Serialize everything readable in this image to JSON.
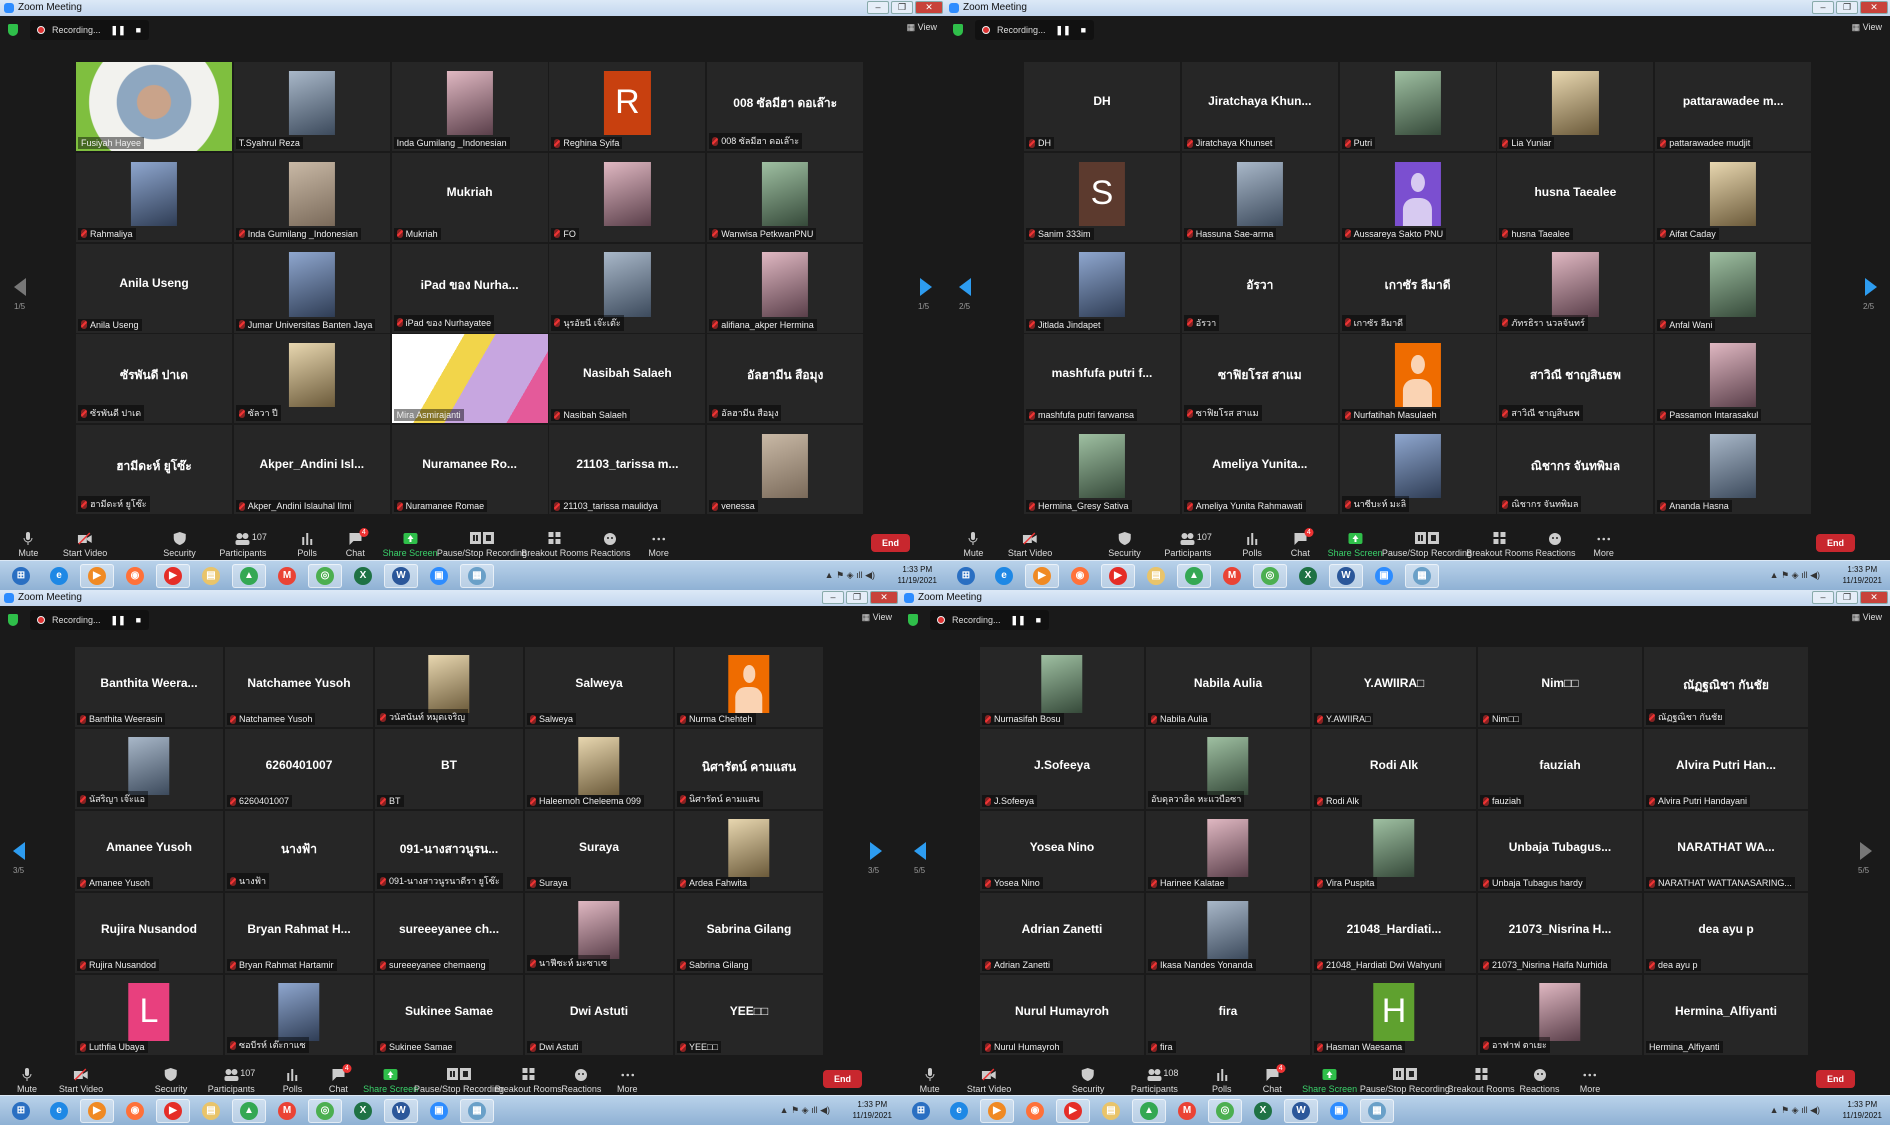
{
  "common": {
    "window_title": "Zoom Meeting",
    "recording_label": "Recording...",
    "pause_icon": "pause-icon",
    "stop_icon": "stop-icon",
    "view_label": "View",
    "toolbar": {
      "mute": "Mute",
      "start_video": "Start Video",
      "security": "Security",
      "participants": "Participants",
      "polls": "Polls",
      "chat": "Chat",
      "chat_badge": "4",
      "share_screen": "Share Screen",
      "recording": "Pause/Stop Recording",
      "breakout": "Breakout Rooms",
      "reactions": "Reactions",
      "more": "More",
      "end": "End"
    },
    "taskbar": {
      "time": "1:33 PM",
      "date": "11/19/2021",
      "apps": [
        "start",
        "internet-explorer",
        "media-player",
        "firefox",
        "youtube",
        "file-explorer",
        "google-drive",
        "gmail",
        "chrome",
        "excel",
        "word",
        "zoom",
        "photo-viewer"
      ]
    },
    "colors": {
      "speaker_border": "#d9f04a",
      "end_button": "#c8272e",
      "share_screen": "#3ad16a",
      "nav_arrow": "#2d9cf0"
    }
  },
  "windows": [
    {
      "page": "1/5",
      "participants_count": "107",
      "prev_enabled": false,
      "next_enabled": true,
      "tiles": [
        {
          "label": "Fusiyah Hayee",
          "kind": "video",
          "speaker": true,
          "muted": false
        },
        {
          "label": "T.Syahrul Reza",
          "kind": "photo",
          "muted": false
        },
        {
          "label": "Inda Gumilang _Indonesian",
          "kind": "photo",
          "muted": false
        },
        {
          "label": "Reghina Syifa",
          "kind": "avatar",
          "letter": "R",
          "color": "#c8400f",
          "muted": true
        },
        {
          "label": "008 ซัลมีฮา ดอเล๊าะ",
          "kind": "name",
          "display": "008 ซัลมีฮา ดอเล๊าะ",
          "muted": true
        },
        {
          "label": "Rahmaliya",
          "kind": "photo",
          "muted": true
        },
        {
          "label": "Inda Gumilang _Indonesian",
          "kind": "photo",
          "muted": true
        },
        {
          "label": "Mukriah",
          "kind": "name",
          "display": "Mukriah",
          "muted": true
        },
        {
          "label": "FO",
          "kind": "photo",
          "muted": true
        },
        {
          "label": "Wanwisa PetkwanPNU",
          "kind": "photo",
          "muted": true
        },
        {
          "label": "Anila Useng",
          "kind": "name",
          "display": "Anila Useng",
          "muted": true
        },
        {
          "label": "Jumar Universitas Banten Jaya",
          "kind": "photo",
          "muted": true
        },
        {
          "label": "iPad ของ Nurhayatee",
          "kind": "name",
          "display": "iPad ของ Nurha...",
          "muted": true
        },
        {
          "label": "นุรอัยนี เจ๊ะเต๊ะ",
          "kind": "photo",
          "muted": true
        },
        {
          "label": "alifiana_akper Hermina",
          "kind": "photo",
          "muted": true
        },
        {
          "label": "ซัรพันดี ปาเด",
          "kind": "name",
          "display": "ซัรพันดี ปาเด",
          "muted": true
        },
        {
          "label": "ซัลวา ปี",
          "kind": "photo",
          "muted": true
        },
        {
          "label": "Mira Asmirajanti",
          "kind": "video",
          "muted": false
        },
        {
          "label": "Nasibah Salaeh",
          "kind": "name",
          "display": "Nasibah Salaeh",
          "muted": true
        },
        {
          "label": "อัลฮามีน สือมุง",
          "kind": "name",
          "display": "อัลฮามีน สือมุง",
          "muted": true
        },
        {
          "label": "ฮามีดะห์ ยูโซ๊ะ",
          "kind": "name",
          "display": "ฮามีดะห์ ยูโซ๊ะ",
          "muted": true
        },
        {
          "label": "Akper_Andini Islauhal Ilmi",
          "kind": "name",
          "display": "Akper_Andini Isl...",
          "muted": true
        },
        {
          "label": "Nuramanee Romae",
          "kind": "name",
          "display": "Nuramanee Ro...",
          "muted": true
        },
        {
          "label": "21103_tarissa maulidya",
          "kind": "name",
          "display": "21103_tarissa m...",
          "muted": true
        },
        {
          "label": "venessa",
          "kind": "photo",
          "muted": true
        }
      ]
    },
    {
      "page": "2/5",
      "participants_count": "107",
      "prev_enabled": true,
      "next_enabled": true,
      "tiles": [
        {
          "label": "DH",
          "kind": "name",
          "display": "DH",
          "muted": true
        },
        {
          "label": "Jiratchaya Khunset",
          "kind": "name",
          "display": "Jiratchaya Khun...",
          "muted": true
        },
        {
          "label": "Putri",
          "kind": "photo",
          "muted": true
        },
        {
          "label": "Lia Yuniar",
          "kind": "photo",
          "muted": true
        },
        {
          "label": "pattarawadee mudjit",
          "kind": "name",
          "display": "pattarawadee m...",
          "muted": true
        },
        {
          "label": "Sanim 333im",
          "kind": "avatar",
          "letter": "S",
          "color": "#5c3a2e",
          "muted": true
        },
        {
          "label": "Hassuna Sae-arma",
          "kind": "photo",
          "muted": true
        },
        {
          "label": "Aussareya Sakto PNU",
          "kind": "person",
          "color": "#7b4fd0",
          "muted": true
        },
        {
          "label": "husna Taealee",
          "kind": "name",
          "display": "husna Taealee",
          "muted": true
        },
        {
          "label": "Aifat Caday",
          "kind": "photo",
          "muted": true
        },
        {
          "label": "Jitlada Jindapet",
          "kind": "photo",
          "muted": true
        },
        {
          "label": "อัรวา",
          "kind": "name",
          "display": "อัรวา",
          "muted": true
        },
        {
          "label": "เกาซัร ลีมาดี",
          "kind": "name",
          "display": "เกาซัร ลีมาดี",
          "muted": true
        },
        {
          "label": "ภัทรธิรา นวลจันทร์",
          "kind": "photo",
          "muted": true
        },
        {
          "label": "Anfal Wani",
          "kind": "photo",
          "muted": true
        },
        {
          "label": "mashfufa putri farwansa",
          "kind": "name",
          "display": "mashfufa putri f...",
          "muted": true
        },
        {
          "label": "ซาฟิยโรส สาแม",
          "kind": "name",
          "display": "ซาฟิยโรส สาแม",
          "muted": true
        },
        {
          "label": "Nurfatihah Masulaeh",
          "kind": "person",
          "color": "#ef6c00",
          "muted": true
        },
        {
          "label": "สาวิณี ชาญสินธพ",
          "kind": "name",
          "display": "สาวิณี ชาญสินธพ",
          "muted": true
        },
        {
          "label": "Passamon Intarasakul",
          "kind": "photo",
          "muted": true
        },
        {
          "label": "Hermina_Gresy Sativa",
          "kind": "photo",
          "muted": true
        },
        {
          "label": "Ameliya Yunita Rahmawati",
          "kind": "name",
          "display": "Ameliya Yunita...",
          "muted": true
        },
        {
          "label": "นาซีบะห์ มะลิ",
          "kind": "photo",
          "muted": true
        },
        {
          "label": "ณิชากร จันทพิมล",
          "kind": "name",
          "display": "ณิชากร จันทพิมล",
          "muted": true
        },
        {
          "label": "Ananda Hasna",
          "kind": "photo",
          "muted": true
        }
      ]
    },
    {
      "page": "3/5",
      "participants_count": "107",
      "prev_enabled": true,
      "next_enabled": true,
      "tiles": [
        {
          "label": "Banthita Weerasin",
          "kind": "name",
          "display": "Banthita Weera...",
          "muted": true
        },
        {
          "label": "Natchamee Yusoh",
          "kind": "name",
          "display": "Natchamee Yusoh",
          "muted": true
        },
        {
          "label": "วนัสนันท์ หมุดเจริญ",
          "kind": "photo",
          "muted": true
        },
        {
          "label": "Salweya",
          "kind": "name",
          "display": "Salweya",
          "muted": true
        },
        {
          "label": "Nurma Chehteh",
          "kind": "person",
          "color": "#ef6c00",
          "muted": true
        },
        {
          "label": "นัสริญา เจ๊ะแอ",
          "kind": "photo",
          "muted": true
        },
        {
          "label": "6260401007",
          "kind": "name",
          "display": "6260401007",
          "muted": true
        },
        {
          "label": "BT",
          "kind": "name",
          "display": "BT",
          "muted": true
        },
        {
          "label": "Haleemoh Cheleema 099",
          "kind": "photo",
          "muted": true
        },
        {
          "label": "นิศารัตน์ คามแสน",
          "kind": "name",
          "display": "นิศารัตน์ คามแสน",
          "muted": true
        },
        {
          "label": "Amanee Yusoh",
          "kind": "name",
          "display": "Amanee Yusoh",
          "muted": true
        },
        {
          "label": "นางฟ้า",
          "kind": "name",
          "display": "นางฟ้า",
          "muted": true
        },
        {
          "label": "091-นางสาวนูรนาดีรา ยูโซ๊ะ",
          "kind": "name",
          "display": "091-นางสาวนูรน...",
          "muted": true
        },
        {
          "label": "Suraya",
          "kind": "name",
          "display": "Suraya",
          "muted": true
        },
        {
          "label": "Ardea Fahwita",
          "kind": "photo",
          "muted": true
        },
        {
          "label": "Rujira Nusandod",
          "kind": "name",
          "display": "Rujira Nusandod",
          "muted": true
        },
        {
          "label": "Bryan Rahmat Hartamir",
          "kind": "name",
          "display": "Bryan Rahmat H...",
          "muted": true
        },
        {
          "label": "sureeeyanee chemaeng",
          "kind": "name",
          "display": "sureeeyanee ch...",
          "muted": true
        },
        {
          "label": "นาฟีซะห์ มะซาเซ",
          "kind": "photo",
          "muted": true
        },
        {
          "label": "Sabrina Gilang",
          "kind": "name",
          "display": "Sabrina Gilang",
          "muted": true
        },
        {
          "label": "Luthfia Ubaya",
          "kind": "avatar",
          "letter": "L",
          "color": "#e8407e",
          "muted": true
        },
        {
          "label": "ซอบีรห์ เต๊ะกาแซ",
          "kind": "photo",
          "muted": true
        },
        {
          "label": "Sukinee Samae",
          "kind": "name",
          "display": "Sukinee Samae",
          "muted": true
        },
        {
          "label": "Dwi Astuti",
          "kind": "name",
          "display": "Dwi Astuti",
          "muted": true
        },
        {
          "label": "YEE□□",
          "kind": "name",
          "display": "YEE□□",
          "muted": true
        }
      ]
    },
    {
      "page": "5/5",
      "participants_count": "108",
      "prev_enabled": true,
      "next_enabled": false,
      "tiles": [
        {
          "label": "Nurnasifah Bosu",
          "kind": "photo",
          "muted": true
        },
        {
          "label": "Nabila Aulia",
          "kind": "name",
          "display": "Nabila Aulia",
          "muted": true
        },
        {
          "label": "Y.AWIIRA□",
          "kind": "name",
          "display": "Y.AWIIRA□",
          "muted": true
        },
        {
          "label": "Nim□□",
          "kind": "name",
          "display": "Nim□□",
          "muted": true
        },
        {
          "label": "ณัฏฐณิชา กันชัย",
          "kind": "name",
          "display": "ณัฏฐณิชา กันชัย",
          "muted": true
        },
        {
          "label": "J.Sofeeya",
          "kind": "name",
          "display": "J.Sofeeya",
          "muted": true
        },
        {
          "label": "อับดุลวาฮิด หะแวบือซา",
          "kind": "photo",
          "muted": false
        },
        {
          "label": "Rodi Alk",
          "kind": "name",
          "display": "Rodi Alk",
          "muted": true
        },
        {
          "label": "fauziah",
          "kind": "name",
          "display": "fauziah",
          "muted": true
        },
        {
          "label": "Alvira Putri Handayani",
          "kind": "name",
          "display": "Alvira Putri Han...",
          "muted": true
        },
        {
          "label": "Yosea Nino",
          "kind": "name",
          "display": "Yosea Nino",
          "muted": true
        },
        {
          "label": "Harinee Kalatae",
          "kind": "photo",
          "muted": true
        },
        {
          "label": "Vira Puspita",
          "kind": "photo",
          "muted": true
        },
        {
          "label": "Unbaja Tubagus hardy",
          "kind": "name",
          "display": "Unbaja Tubagus...",
          "muted": true
        },
        {
          "label": "NARATHAT WATTANASARING...",
          "kind": "name",
          "display": "NARATHAT WA...",
          "muted": true
        },
        {
          "label": "Adrian Zanetti",
          "kind": "name",
          "display": "Adrian Zanetti",
          "muted": true
        },
        {
          "label": "Ikasa Nandes Yonanda",
          "kind": "photo",
          "muted": true
        },
        {
          "label": "21048_Hardiati Dwi Wahyuni",
          "kind": "name",
          "display": "21048_Hardiati...",
          "muted": true
        },
        {
          "label": "21073_Nisrina Haifa Nurhida",
          "kind": "name",
          "display": "21073_Nisrina H...",
          "muted": true
        },
        {
          "label": "dea ayu p",
          "kind": "name",
          "display": "dea ayu p",
          "muted": true
        },
        {
          "label": "Nurul Humayroh",
          "kind": "name",
          "display": "Nurul Humayroh",
          "muted": true
        },
        {
          "label": "fira",
          "kind": "name",
          "display": "fira",
          "muted": true
        },
        {
          "label": "Hasman Waesama",
          "kind": "avatar",
          "letter": "H",
          "color": "#5fa12f",
          "muted": true
        },
        {
          "label": "อาฟาฟ ตาเยะ",
          "kind": "photo",
          "muted": true
        },
        {
          "label": "Hermina_Alfiyanti",
          "kind": "name",
          "display": "Hermina_Alfiyanti",
          "muted": false
        }
      ]
    }
  ]
}
